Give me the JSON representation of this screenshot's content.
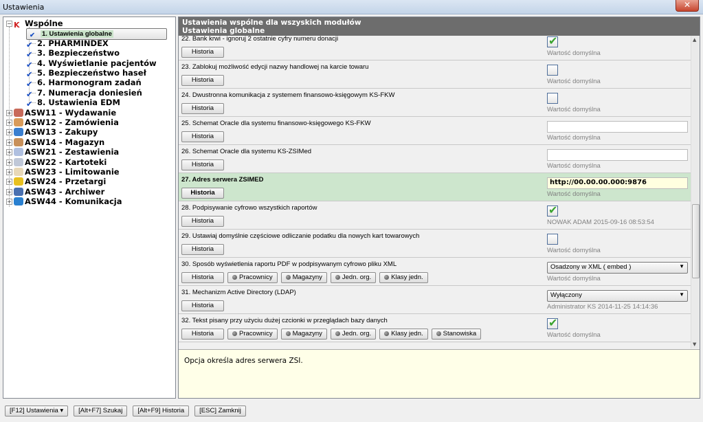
{
  "window": {
    "title": "Ustawienia",
    "close_label": "✕"
  },
  "tree": {
    "root": {
      "label": "Wspólne",
      "icon": "ks-logo-icon",
      "children": [
        "1. Ustawienia globalne",
        "2. PHARMINDEX",
        "3. Bezpieczeństwo",
        "4. Wyświetlanie pacjentów",
        "5. Bezpieczeństwo haseł",
        "6. Harmonogram zadań",
        "7. Numeracja doniesień",
        "8. Ustawienia EDM"
      ]
    },
    "selected": "1. Ustawienia globalne",
    "modules": [
      {
        "label": "ASW11 - Wydawanie",
        "icon": "people-icon",
        "color": "#c86a5a"
      },
      {
        "label": "ASW12 - Zamówienia",
        "icon": "person-icon",
        "color": "#d99b5a"
      },
      {
        "label": "ASW13 - Zakupy",
        "icon": "box-icon",
        "color": "#3a7fd0"
      },
      {
        "label": "ASW14 - Magazyn",
        "icon": "boxes-icon",
        "color": "#c8905a"
      },
      {
        "label": "ASW21 - Zestawienia",
        "icon": "bottle-icon",
        "color": "#b0c0e0"
      },
      {
        "label": "ASW22 - Kartoteki",
        "icon": "tray-icon",
        "color": "#c0c8d8"
      },
      {
        "label": "ASW23 - Limitowanie",
        "icon": "hand-icon",
        "color": "#e8d8b8"
      },
      {
        "label": "ASW24 - Przetargi",
        "icon": "folder-icon",
        "color": "#e8c020"
      },
      {
        "label": "ASW43 - Archiwer",
        "icon": "archive-icon",
        "color": "#4a70b0"
      },
      {
        "label": "ASW44 - Komunikacja",
        "icon": "globe-icon",
        "color": "#2a80d0"
      }
    ]
  },
  "header": {
    "line1": "Ustawienia wspólne dla wszyskich modułów",
    "line2": "Ustawienia globalne"
  },
  "settings": [
    {
      "label": "22.  Bank krwi - ignoruj 2 ostatnie cyfry numeru donacji",
      "buttons": [
        "Historia"
      ],
      "control": "checkbox",
      "checked": true,
      "sub": "Wartość domyślna"
    },
    {
      "label": "23.  Zablokuj możliwość edycji nazwy handlowej na karcie towaru",
      "buttons": [
        "Historia"
      ],
      "control": "checkbox",
      "checked": false,
      "sub": "Wartość domyślna"
    },
    {
      "label": "24.  Dwustronna komunikacja z systemem finansowo-księgowym KS-FKW",
      "buttons": [
        "Historia"
      ],
      "control": "checkbox",
      "checked": false,
      "sub": "Wartość domyślna"
    },
    {
      "label": "25.  Schemat Oracle dla systemu finansowo-księgowego KS-FKW",
      "buttons": [
        "Historia"
      ],
      "control": "text",
      "value": "",
      "sub": "Wartość domyślna"
    },
    {
      "label": "26.  Schemat Oracle dla systemu KS-ZSIMed",
      "buttons": [
        "Historia"
      ],
      "control": "text",
      "value": "",
      "sub": "Wartość domyślna"
    },
    {
      "label": "27.  Adres serwera ZSIMED",
      "buttons": [
        "Historia"
      ],
      "control": "text",
      "value": "http://00.00.00.000:9876",
      "sub": "Wartość domyślna",
      "selected": true
    },
    {
      "label": "28.  Podpisywanie cyfrowo wszystkich raportów",
      "buttons": [
        "Historia"
      ],
      "control": "checkbox",
      "checked": true,
      "sub": "NOWAK ADAM 2015-09-16 08:53:54"
    },
    {
      "label": "29.  Ustawiaj domyślnie częściowe odliczanie podatku dla nowych kart towarowych",
      "buttons": [
        "Historia"
      ],
      "control": "checkbox",
      "checked": false,
      "sub": "Wartość domyślna"
    },
    {
      "label": "30.  Sposób wyświetlenia raportu PDF w podpisywanym cyfrowo pliku XML",
      "buttons": [
        "Historia",
        "Pracownicy",
        "Magazyny",
        "Jedn. org.",
        "Klasy jedn."
      ],
      "control": "select",
      "value": "Osadzony w XML ( embed )",
      "sub": "Wartość domyślna"
    },
    {
      "label": "31.  Mechanizm Active Directory (LDAP)",
      "buttons": [
        "Historia"
      ],
      "control": "select",
      "value": "Wyłączony",
      "sub": "Administrator KS 2014-11-25 14:14:36"
    },
    {
      "label": "32.  Tekst pisany przy użyciu dużej czcionki w przeglądach bazy danych",
      "buttons": [
        "Historia",
        "Pracownicy",
        "Magazyny",
        "Jedn. org.",
        "Klasy jedn.",
        "Stanowiska"
      ],
      "control": "checkbox",
      "checked": true,
      "sub": "Wartość domyślna"
    }
  ],
  "description": "Opcja określa adres serwera ZSI.",
  "footer": {
    "buttons": [
      "[F12] Ustawienia ▾",
      "[Alt+F7] Szukaj",
      "[Alt+F9] Historia",
      "[ESC] Zamknij"
    ]
  },
  "colors": {
    "selected_row": "#cde6cd",
    "header": "#6d6d6d",
    "description_bg": "#ffffe8"
  }
}
